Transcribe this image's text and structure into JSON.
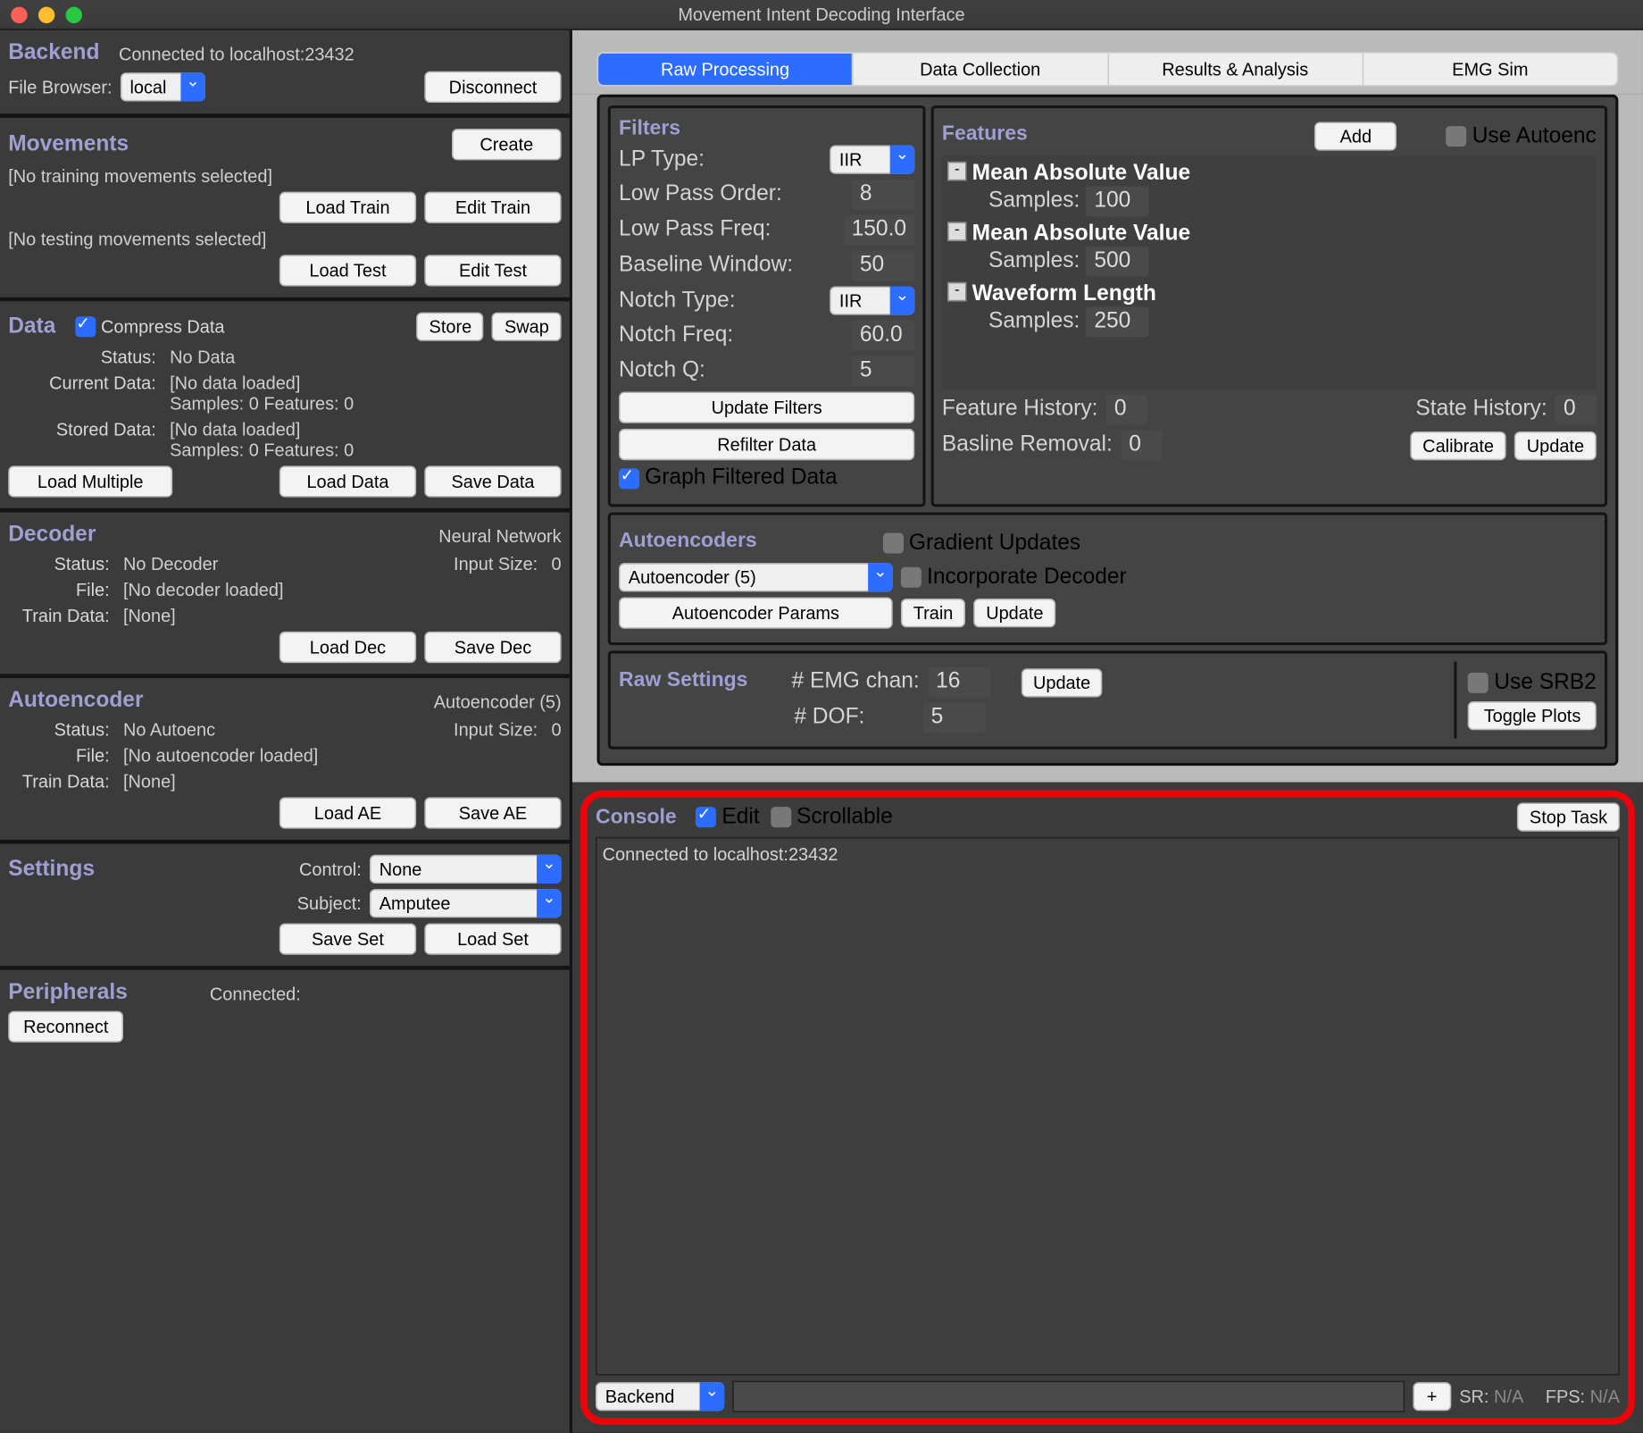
{
  "title": "Movement Intent Decoding Interface",
  "left": {
    "backend": {
      "heading": "Backend",
      "connected": "Connected to localhost:23432",
      "file_browser_label": "File Browser:",
      "file_browser_value": "local",
      "disconnect": "Disconnect"
    },
    "movements": {
      "heading": "Movements",
      "create": "Create",
      "no_train": "[No training movements selected]",
      "load_train": "Load Train",
      "edit_train": "Edit Train",
      "no_test": "[No testing movements selected]",
      "load_test": "Load Test",
      "edit_test": "Edit Test"
    },
    "data": {
      "heading": "Data",
      "compress": "Compress Data",
      "store": "Store",
      "swap": "Swap",
      "status_label": "Status:",
      "status_value": "No Data",
      "current_label": "Current Data:",
      "noload": "[No data loaded]",
      "samples_features": "Samples: 0  Features: 0",
      "stored_label": "Stored Data:",
      "load_multiple": "Load Multiple",
      "load_data": "Load Data",
      "save_data": "Save Data"
    },
    "decoder": {
      "heading": "Decoder",
      "type": "Neural Network",
      "status_label": "Status:",
      "status_value": "No Decoder",
      "input_size_label": "Input Size:",
      "input_size_value": "0",
      "file_label": "File:",
      "file_value": "[No decoder loaded]",
      "train_label": "Train Data:",
      "train_value": "[None]",
      "load": "Load Dec",
      "save": "Save Dec"
    },
    "autoenc": {
      "heading": "Autoencoder",
      "type": "Autoencoder (5)",
      "status_label": "Status:",
      "status_value": "No Autoenc",
      "input_size_label": "Input Size:",
      "input_size_value": "0",
      "file_label": "File:",
      "file_value": "[No autoencoder loaded]",
      "train_label": "Train Data:",
      "train_value": "[None]",
      "load": "Load AE",
      "save": "Save AE"
    },
    "settings": {
      "heading": "Settings",
      "control_label": "Control:",
      "control_value": "None",
      "subject_label": "Subject:",
      "subject_value": "Amputee",
      "save": "Save Set",
      "load": "Load Set"
    },
    "peripherals": {
      "heading": "Peripherals",
      "connected_label": "Connected:",
      "reconnect": "Reconnect"
    }
  },
  "tabs": {
    "raw": "Raw Processing",
    "data": "Data Collection",
    "results": "Results & Analysis",
    "emg": "EMG Sim"
  },
  "filters": {
    "heading": "Filters",
    "lp_type_label": "LP Type:",
    "lp_type_value": "IIR",
    "lp_order_label": "Low Pass Order:",
    "lp_order_value": "8",
    "lp_freq_label": "Low Pass Freq:",
    "lp_freq_value": "150.0",
    "baseline_label": "Baseline Window:",
    "baseline_value": "50",
    "notch_type_label": "Notch Type:",
    "notch_type_value": "IIR",
    "notch_freq_label": "Notch Freq:",
    "notch_freq_value": "60.0",
    "notch_q_label": "Notch Q:",
    "notch_q_value": "5",
    "update": "Update Filters",
    "refilter": "Refilter Data",
    "graph_chk": "Graph Filtered Data"
  },
  "features": {
    "heading": "Features",
    "add": "Add",
    "use_autoenc": "Use Autoenc",
    "items": [
      {
        "name": "Mean Absolute Value",
        "label": "Samples:",
        "value": "100"
      },
      {
        "name": "Mean Absolute Value",
        "label": "Samples:",
        "value": "500"
      },
      {
        "name": "Waveform Length",
        "label": "Samples:",
        "value": "250"
      }
    ],
    "feat_hist_label": "Feature History:",
    "feat_hist_value": "0",
    "state_hist_label": "State History:",
    "state_hist_value": "0",
    "baseline_label": "Basline Removal:",
    "baseline_value": "0",
    "calibrate": "Calibrate",
    "update": "Update"
  },
  "autoencoders": {
    "heading": "Autoencoders",
    "select": "Autoencoder (5)",
    "params": "Autoencoder Params",
    "grad": "Gradient Updates",
    "incorp": "Incorporate Decoder",
    "train": "Train",
    "update": "Update"
  },
  "rawsettings": {
    "heading": "Raw Settings",
    "emg_label": "# EMG chan:",
    "emg_value": "16",
    "dof_label": "# DOF:",
    "dof_value": "5",
    "update": "Update",
    "srb2": "Use SRB2",
    "toggle": "Toggle Plots"
  },
  "console": {
    "heading": "Console",
    "edit": "Edit",
    "scroll": "Scrollable",
    "stop": "Stop Task",
    "body": "Connected to localhost:23432",
    "target": "Backend",
    "plus": "+",
    "sr_label": "SR:",
    "sr_value": "N/A",
    "fps_label": "FPS:",
    "fps_value": "N/A"
  }
}
